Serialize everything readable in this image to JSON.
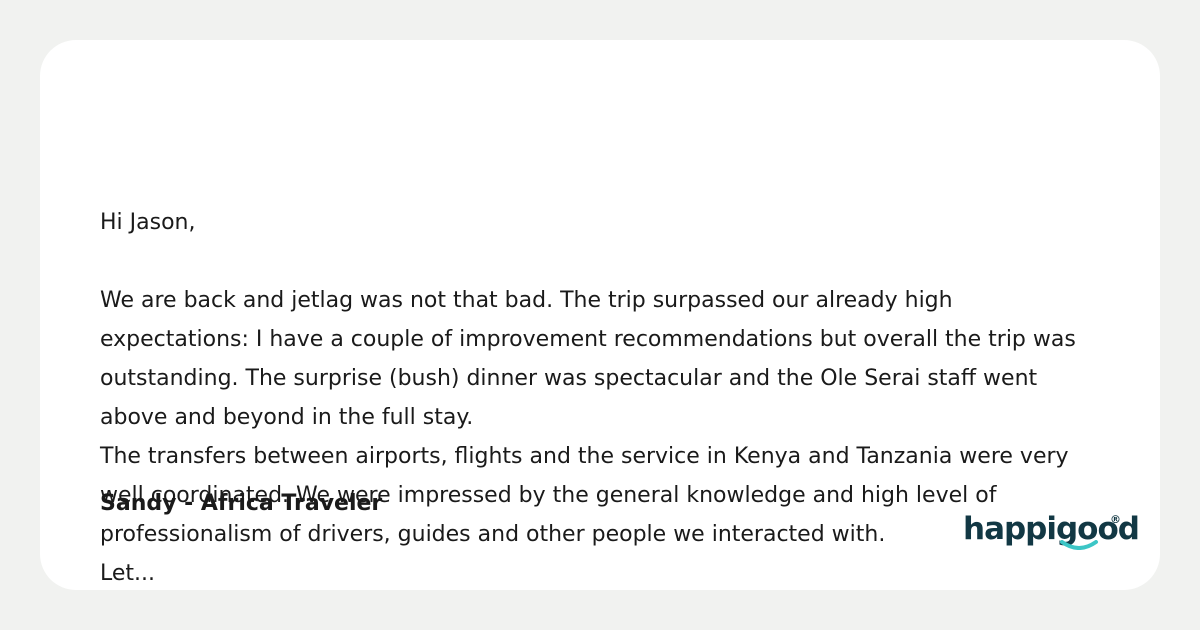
{
  "testimonial": {
    "message": "Hi Jason,\n\nWe are back and jetlag was not that bad. The trip surpassed our already high expectations: I have a couple of improvement recommendations but overall the trip was outstanding. The surprise (bush) dinner was spectacular and the Ole Serai staff went above and beyond in the full stay.\nThe transfers between airports, flights and the service in Kenya and Tanzania were very well coordinated. We were impressed by the general knowledge and high level of professionalism of drivers, guides and other people we interacted with.\nLet...",
    "author": "Sandy - Africa Traveler"
  },
  "brand": {
    "logo_text": "happigood",
    "registered_mark": "®",
    "logo_color": "#123844",
    "accent_color": "#3cc6c6"
  }
}
